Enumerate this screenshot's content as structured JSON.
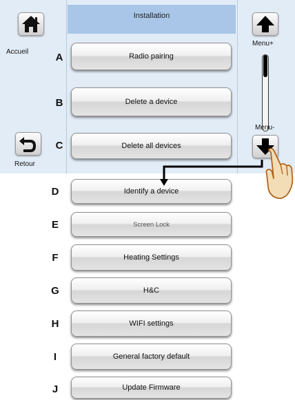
{
  "header": {
    "title": "Installation"
  },
  "left_sidebar": {
    "home_label": "Accueil",
    "back_label": "Retour"
  },
  "right_sidebar": {
    "up_label": "Menu+",
    "down_label": "Menu-"
  },
  "scrollbar": {
    "position": 0.0
  },
  "menu_items": [
    {
      "letter": "A",
      "label": "Radio pairing"
    },
    {
      "letter": "B",
      "label": "Delete a device"
    },
    {
      "letter": "C",
      "label": "Delete all devices"
    },
    {
      "letter": "D",
      "label": "Identify a device"
    },
    {
      "letter": "E",
      "label": "Screen Lock"
    },
    {
      "letter": "F",
      "label": "Heating Settings"
    },
    {
      "letter": "G",
      "label": "H&C"
    },
    {
      "letter": "H",
      "label": "WIFI settings"
    },
    {
      "letter": "I",
      "label": "General factory default"
    },
    {
      "letter": "J",
      "label": "Update Firmware"
    }
  ]
}
